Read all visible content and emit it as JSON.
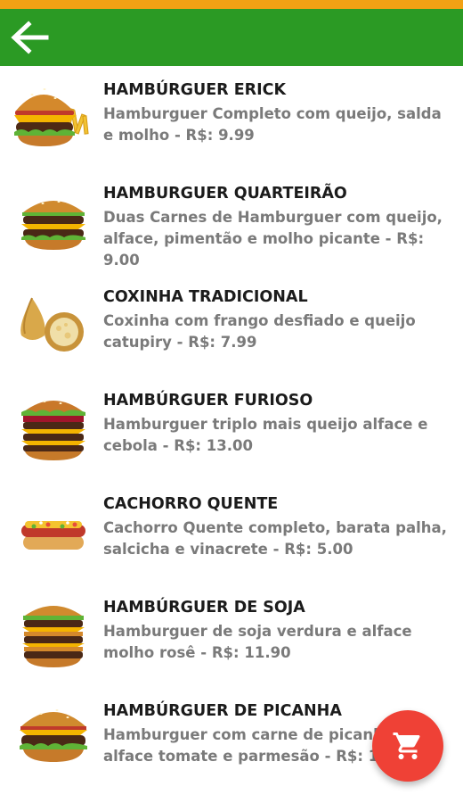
{
  "colors": {
    "status_bar": "#f2a114",
    "app_bar": "#2b9a24",
    "fab": "#ef4136"
  },
  "toolbar": {
    "back_icon": "arrow-left-icon"
  },
  "items": [
    {
      "title": "HAMBÚRGUER ERICK",
      "desc": "Hamburguer Completo com queijo, salda e molho - R$: 9.99",
      "image": "burger-with-fries-image"
    },
    {
      "title": "HAMBURGUER QUARTEIRÃO",
      "desc": "Duas Carnes de Hamburguer com queijo, alface, pimentão e molho picante - R$: 9.00",
      "image": "double-burger-image"
    },
    {
      "title": "COXINHA TRADICIONAL",
      "desc": "Coxinha com frango desfiado e queijo catupiry - R$: 7.99",
      "image": "coxinha-image"
    },
    {
      "title": "HAMBÚRGUER FURIOSO",
      "desc": "Hamburguer triplo mais queijo alface e cebola - R$: 13.00",
      "image": "triple-burger-image"
    },
    {
      "title": "CACHORRO QUENTE",
      "desc": "Cachorro Quente completo, barata palha, salcicha e vinacrete - R$: 5.00",
      "image": "hot-dog-image"
    },
    {
      "title": "HAMBÚRGUER DE SOJA",
      "desc": "Hamburguer de soja verdura e alface molho rosê  - R$: 11.90",
      "image": "stacked-burger-image"
    },
    {
      "title": "HAMBÚRGUER DE PICANHA",
      "desc": "Hamburguer com carne de picanha, alface tomate e parmesão  - R$: 15.00",
      "image": "picanha-burger-image"
    }
  ],
  "fab": {
    "icon": "cart-icon"
  }
}
